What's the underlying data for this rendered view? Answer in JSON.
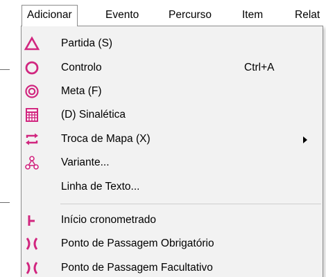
{
  "menubar": {
    "items": [
      {
        "label": "Adicionar"
      },
      {
        "label": "Evento"
      },
      {
        "label": "Percurso"
      },
      {
        "label": "Item"
      },
      {
        "label": "Relat"
      }
    ]
  },
  "menu": {
    "items": [
      {
        "label": "Partida (S)",
        "icon": "start-triangle-icon"
      },
      {
        "label": "Controlo",
        "shortcut": "Ctrl+A",
        "icon": "control-circle-icon"
      },
      {
        "label": "Meta (F)",
        "icon": "finish-double-circle-icon"
      },
      {
        "label": "(D) Sinalética",
        "icon": "description-grid-icon"
      },
      {
        "label": "Troca de Mapa (X)",
        "icon": "map-exchange-icon",
        "has_submenu": true
      },
      {
        "label": "Variante...",
        "icon": "variant-branch-icon"
      },
      {
        "label": "Linha de Texto...",
        "icon": ""
      },
      {
        "label": "Início cronometrado",
        "icon": "timed-start-icon"
      },
      {
        "label": "Ponto de Passagem Obrigatório",
        "icon": "mandatory-crossing-icon"
      },
      {
        "label": "Ponto de Passagem Facultativo",
        "icon": "optional-crossing-icon"
      }
    ]
  },
  "colors": {
    "icon_magenta": "#d1267f",
    "menu_background": "#f2f2f2",
    "menu_border": "#8c8c8c"
  }
}
